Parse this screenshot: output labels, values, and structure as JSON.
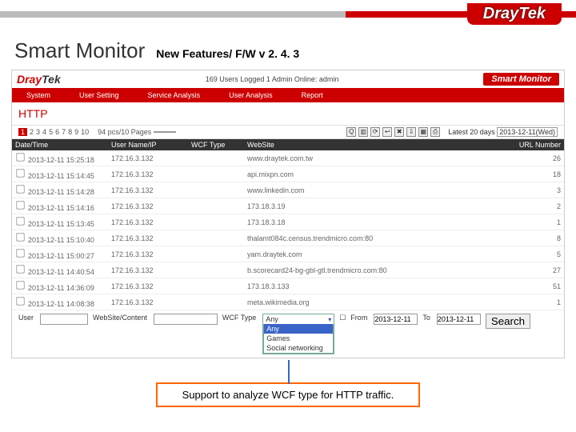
{
  "slide": {
    "logo_text": "DrayTek",
    "title": "Smart Monitor",
    "subtitle": "New Features/ F/W v 2. 4. 3",
    "callout": "Support to analyze WCF type for HTTP traffic."
  },
  "app": {
    "logo": "DrayTek",
    "status": "169 Users Logged  1 Admin Online: admin",
    "badge": "Smart Monitor",
    "nav": [
      "System",
      "User Setting",
      "Service Analysis",
      "User Analysis",
      "Report"
    ],
    "section": "HTTP",
    "pager": {
      "pages": [
        "1",
        "2",
        "3",
        "4",
        "5",
        "6",
        "7",
        "8",
        "9",
        "10"
      ],
      "info": "94 pcs/10 Pages",
      "per_page": ""
    },
    "date_info": {
      "label": "Latest 20 days",
      "value": "2013-12-11(Wed)"
    },
    "icon_names": [
      "search",
      "chart",
      "refresh",
      "back",
      "delete",
      "export",
      "calendar",
      "print"
    ],
    "columns": [
      "Date/Time",
      "User Name/IP",
      "WCF Type",
      "WebSite",
      "URL Number"
    ],
    "rows": [
      {
        "dt": "2013-12-11 15:25:18",
        "ip": "172.16.3.132",
        "wcf": "",
        "site": "www.draytek.com.tw",
        "n": "26"
      },
      {
        "dt": "2013-12-11 15:14:45",
        "ip": "172.16.3.132",
        "wcf": "",
        "site": "api.mixpn.com",
        "n": "18"
      },
      {
        "dt": "2013-12-11 15:14:28",
        "ip": "172.16.3.132",
        "wcf": "",
        "site": "www.linkedin.com",
        "n": "3"
      },
      {
        "dt": "2013-12-11 15:14:16",
        "ip": "172.16.3.132",
        "wcf": "",
        "site": "173.18.3.19",
        "n": "2"
      },
      {
        "dt": "2013-12-11 15:13:45",
        "ip": "172.16.3.132",
        "wcf": "",
        "site": "173.18.3.18",
        "n": "1"
      },
      {
        "dt": "2013-12-11 15:10:40",
        "ip": "172.16.3.132",
        "wcf": "",
        "site": "thalamt084c.census.trendmicro.com:80",
        "n": "8"
      },
      {
        "dt": "2013-12-11 15:00:27",
        "ip": "172.16.3.132",
        "wcf": "",
        "site": "yam.draytek.com",
        "n": "5"
      },
      {
        "dt": "2013-12-11 14:40:54",
        "ip": "172.16.3.132",
        "wcf": "",
        "site": "b.scorecard24-bg-gbl-gtl.trendmicro.com:80",
        "n": "27"
      },
      {
        "dt": "2013-12-11 14:36:09",
        "ip": "172.16.3.132",
        "wcf": "",
        "site": "173.18.3.133",
        "n": "51"
      },
      {
        "dt": "2013-12-11 14:08:38",
        "ip": "172.16.3.132",
        "wcf": "",
        "site": "meta.wikimedia.org",
        "n": "1"
      }
    ],
    "filter": {
      "user_label": "User",
      "site_label": "WebSite/Content",
      "wcf_label": "WCF Type",
      "from_label": "From",
      "to_label": "To",
      "from_val": "2013-12-11",
      "to_val": "2013-12-11",
      "search": "Search",
      "wcf_selected": "Any",
      "wcf_options": [
        "Any",
        "Games",
        "Social networking"
      ]
    }
  }
}
